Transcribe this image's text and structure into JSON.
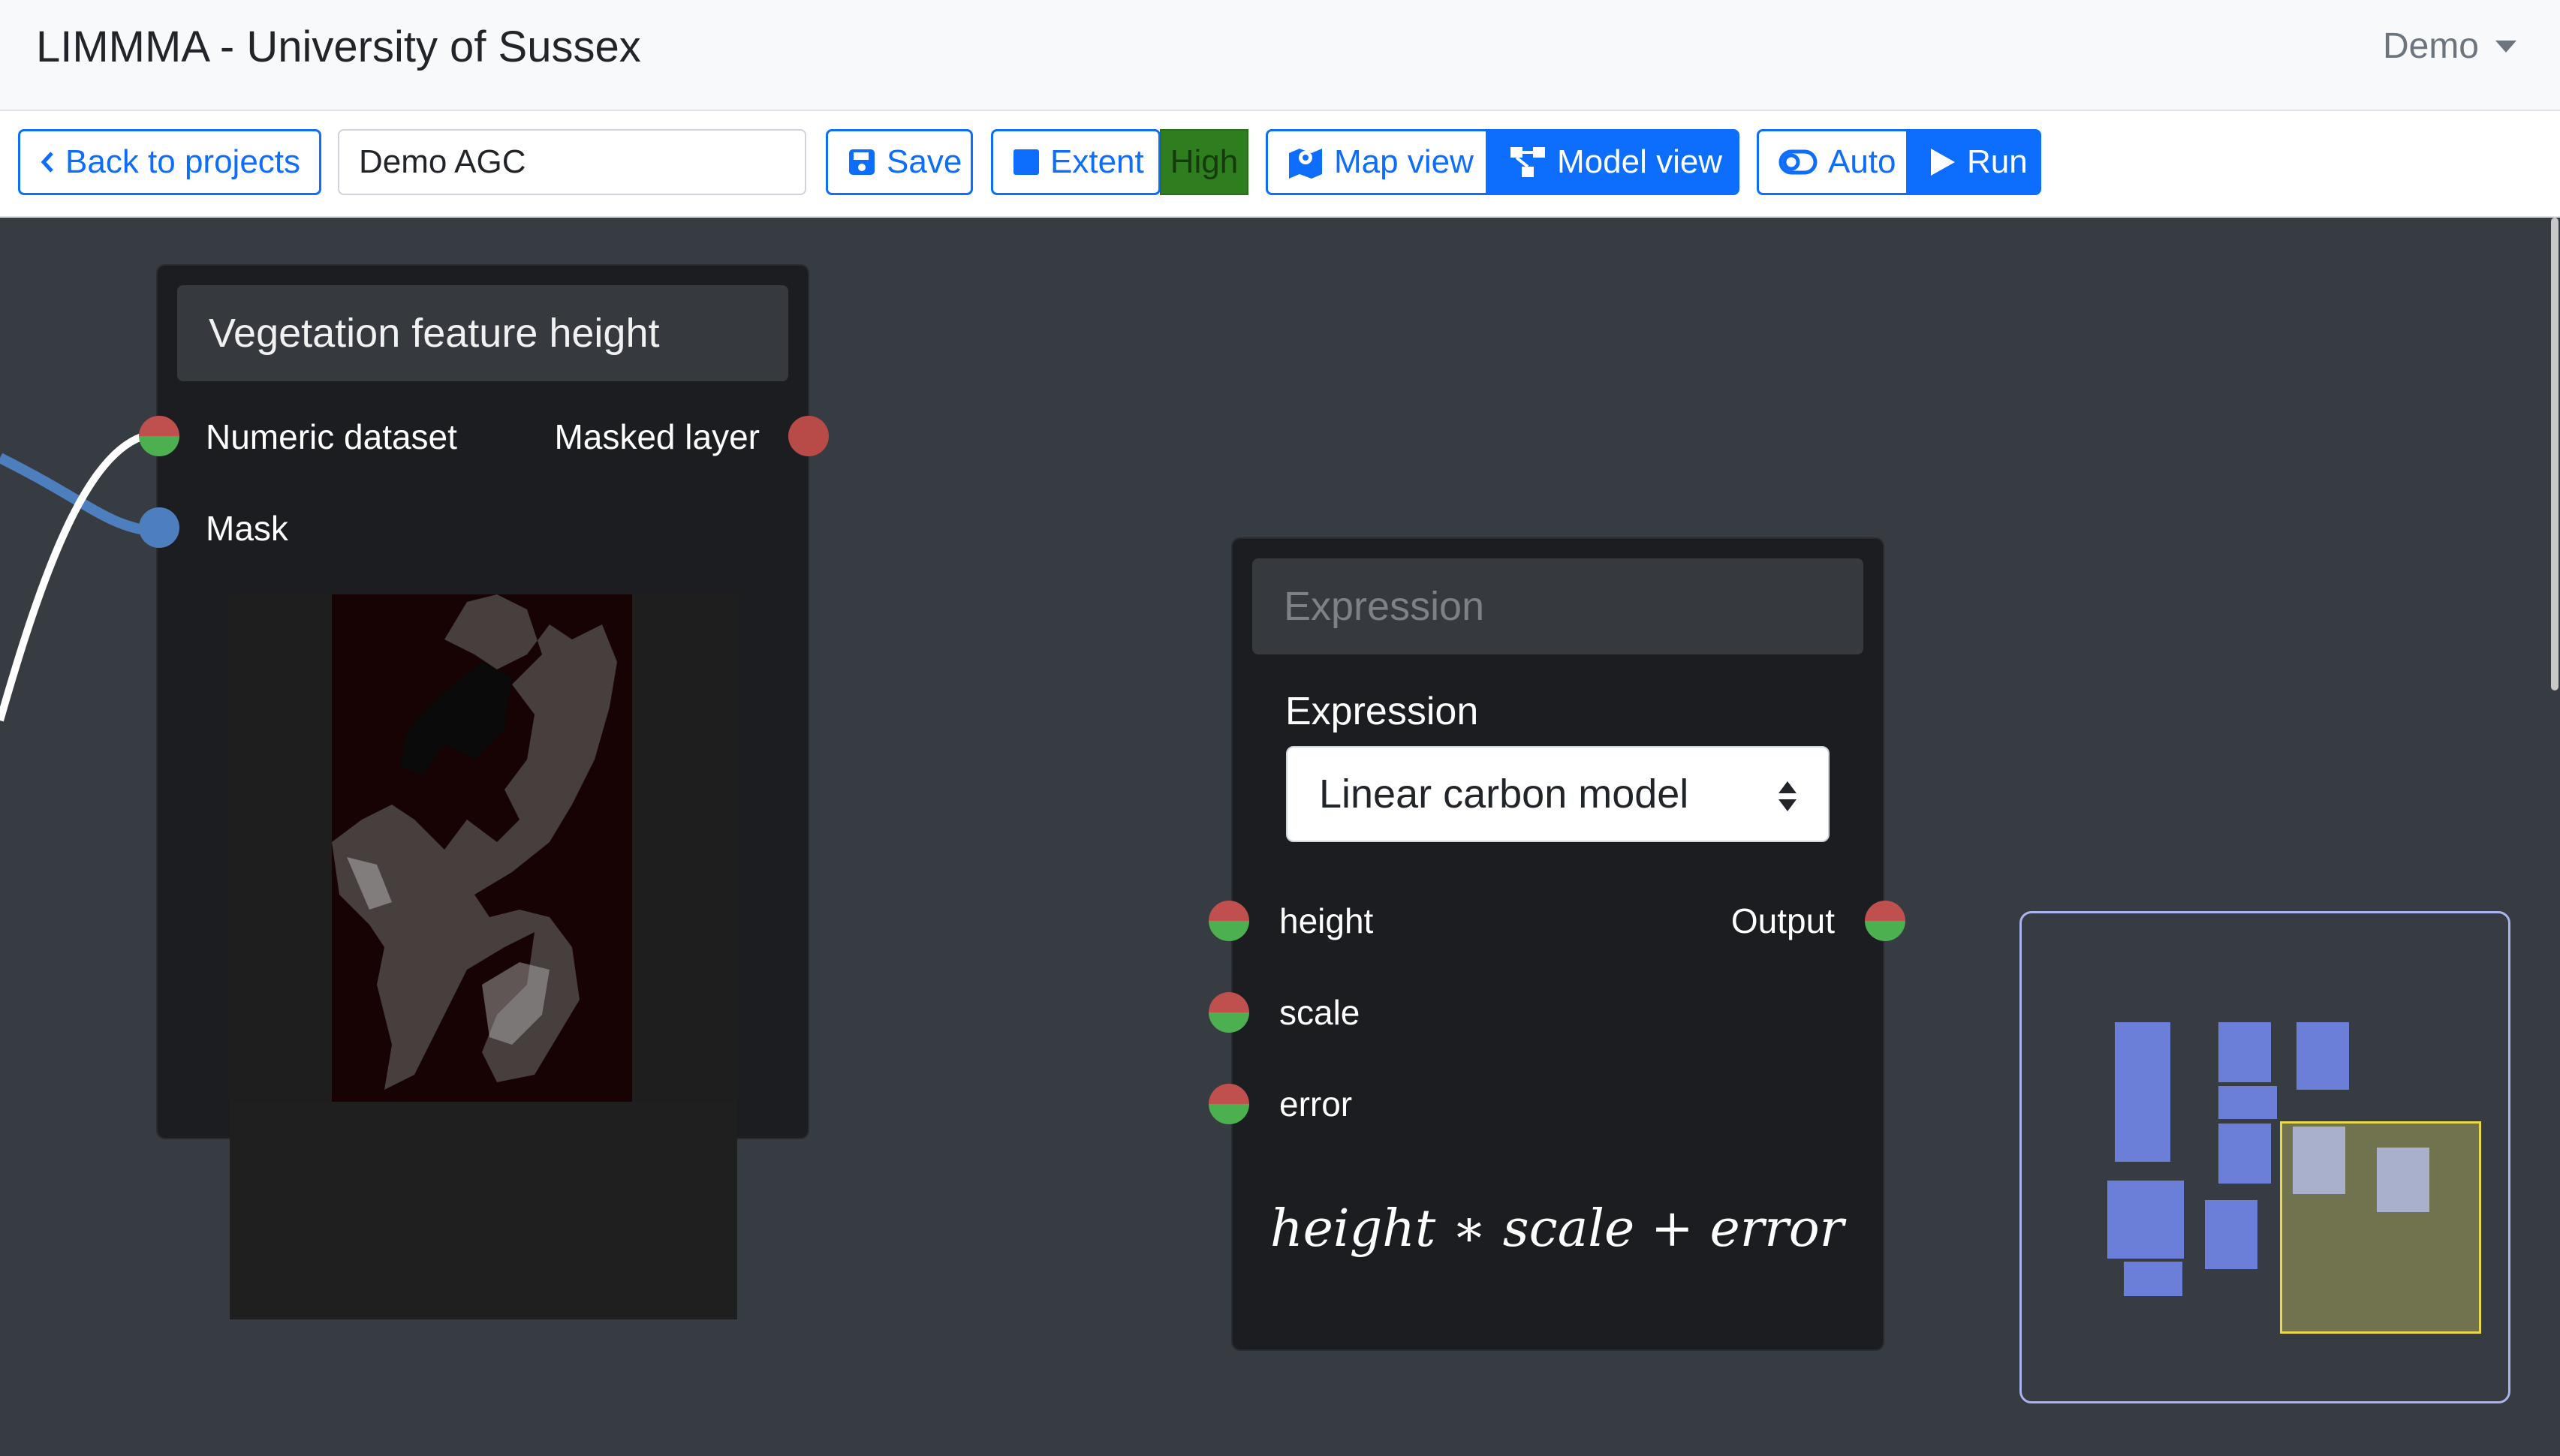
{
  "navbar": {
    "title": "LIMMMA - University of Sussex",
    "user_menu": "Demo"
  },
  "toolbar": {
    "back_label": "Back to projects",
    "project_name": "Demo AGC",
    "save_label": "Save",
    "extent_label": "Extent",
    "resolution_badge": "High",
    "map_view_label": "Map view",
    "model_view_label": "Model view",
    "auto_label": "Auto",
    "run_label": "Run"
  },
  "nodes": {
    "vegetation": {
      "title": "Vegetation feature height",
      "inputs": [
        "Numeric dataset",
        "Mask"
      ],
      "outputs": [
        "Masked layer"
      ]
    },
    "expression": {
      "title_placeholder": "Expression",
      "field_label": "Expression",
      "selected_expression": "Linear carbon model",
      "inputs": [
        "height",
        "scale",
        "error"
      ],
      "outputs": [
        "Output"
      ],
      "formula": "height ∗ scale + error"
    }
  },
  "colors": {
    "accent": "#0d6efd",
    "canvas_bg": "#373c42",
    "node_bg": "#1c1d20",
    "port_red": "#c0504d",
    "port_green": "#4caf50",
    "port_blue": "#4d7fbf",
    "badge_high": "#2e7d1e",
    "minimap_node": "#6c7fd8",
    "minimap_viewport_border": "#e8d84a"
  },
  "icons": {
    "back": "chevron-left-icon",
    "save": "floppy-disk-icon",
    "extent": "square-icon",
    "map_view": "map-icon",
    "model_view": "diagram-icon",
    "auto": "toggle-icon",
    "run": "play-icon"
  }
}
